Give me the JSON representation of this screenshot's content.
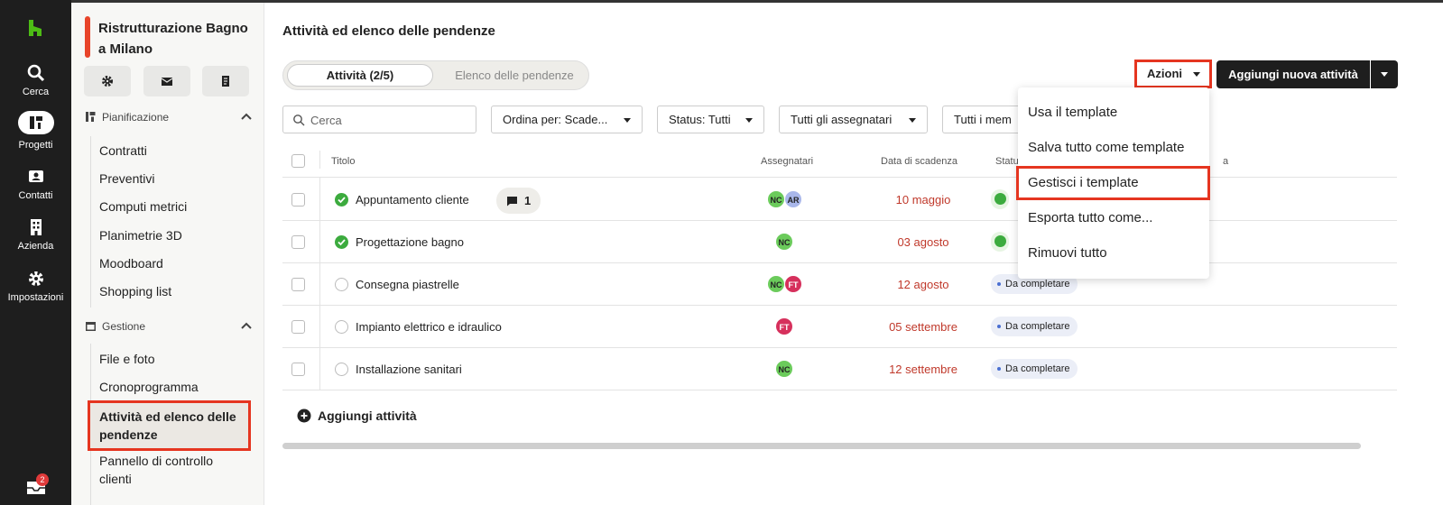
{
  "rail": {
    "items": [
      {
        "label": "Cerca",
        "icon": "search-icon"
      },
      {
        "label": "Progetti",
        "icon": "projects-icon"
      },
      {
        "label": "Contatti",
        "icon": "contacts-icon"
      },
      {
        "label": "Azienda",
        "icon": "building-icon"
      },
      {
        "label": "Impostazioni",
        "icon": "gear-icon"
      }
    ],
    "inbox_count": "2"
  },
  "sidebar": {
    "project_title": "Ristrutturazione Bagno a Milano",
    "sections": [
      {
        "title": "Pianificazione",
        "items": [
          "Contratti",
          "Preventivi",
          "Computi metrici",
          "Planimetrie 3D",
          "Moodboard",
          "Shopping list"
        ]
      },
      {
        "title": "Gestione",
        "items": [
          "File e foto",
          "Cronoprogramma",
          "Attività ed elenco delle pendenze",
          "Pannello di controllo clienti"
        ]
      }
    ]
  },
  "main": {
    "page_title": "Attività ed elenco delle pendenze",
    "tabs": [
      "Attività (2/5)",
      "Elenco delle pendenze"
    ],
    "actions_label": "Azioni",
    "add_task_label": "Aggiungi nuova attività",
    "search_placeholder": "Cerca",
    "filters": [
      "Ordina per: Scade...",
      "Status: Tutti",
      "Tutti gli assegnatari",
      "Tutti i mem"
    ],
    "columns": [
      "Titolo",
      "Assegnatari",
      "Data di scadenza",
      "Statu",
      "a"
    ],
    "rows": [
      {
        "title": "Appuntamento cliente",
        "done": true,
        "comments": "1",
        "assignees": [
          "NC",
          "AR"
        ],
        "due": "10 maggio",
        "status": ""
      },
      {
        "title": "Progettazione bagno",
        "done": true,
        "comments": "",
        "assignees": [
          "NC"
        ],
        "due": "03 agosto",
        "status": ""
      },
      {
        "title": "Consegna piastrelle",
        "done": false,
        "comments": "",
        "assignees": [
          "NC",
          "FT"
        ],
        "due": "12 agosto",
        "status": "Da completare"
      },
      {
        "title": "Impianto elettrico e idraulico",
        "done": false,
        "comments": "",
        "assignees": [
          "FT"
        ],
        "due": "05 settembre",
        "status": "Da completare"
      },
      {
        "title": "Installazione sanitari",
        "done": false,
        "comments": "",
        "assignees": [
          "NC"
        ],
        "due": "12 settembre",
        "status": "Da completare"
      }
    ],
    "add_activity_label": "Aggiungi attività"
  },
  "menu": {
    "items": [
      "Usa il template",
      "Salva tutto come template",
      "Gestisci i template",
      "Esporta tutto come...",
      "Rimuovi tutto"
    ]
  },
  "colors": {
    "rail_bg": "#1e1e1e",
    "highlight": "#e53520",
    "done_green": "#3cab3e",
    "due_red": "#c0392b"
  }
}
